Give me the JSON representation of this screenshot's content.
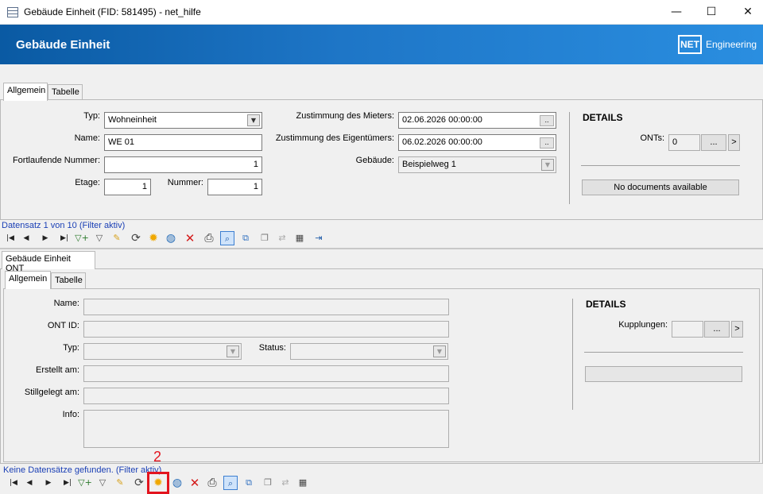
{
  "window": {
    "title": "Gebäude Einheit (FID: 581495) - net_hilfe",
    "minimize": "—",
    "maximize": "☐",
    "close": "✕"
  },
  "banner": {
    "title": "Gebäude Einheit",
    "logo": "NET",
    "logo_text": "Engineering"
  },
  "top_tabs": [
    "Allgemein",
    "Tabelle"
  ],
  "top_form": {
    "typ_label": "Typ:",
    "typ_value": "Wohneinheit",
    "name_label": "Name:",
    "name_value": "WE 01",
    "fortlaufende_label": "Fortlaufende Nummer:",
    "fortlaufende_value": "1",
    "etage_label": "Etage:",
    "etage_value": "1",
    "nummer_label": "Nummer:",
    "nummer_value": "1",
    "mieter_label": "Zustimmung des Mieters:",
    "mieter_value": "02.06.2026 00:00:00",
    "eigentuemer_label": "Zustimmung des Eigentümers:",
    "eigentuemer_value": "06.02.2026 00:00:00",
    "gebaeude_label": "Gebäude:",
    "gebaeude_value": "Beispielweg 1",
    "dots": ".."
  },
  "top_details": {
    "heading": "DETAILS",
    "onts_label": "ONTs:",
    "onts_value": "0",
    "more": "...",
    "arrow": ">",
    "no_docs": "No documents available"
  },
  "top_status": "Datensatz 1 von 10 (Filter aktiv)",
  "ont_section": {
    "tab": "Gebäude Einheit ONT",
    "subtabs": [
      "Allgemein",
      "Tabelle"
    ]
  },
  "ont_form": {
    "name_label": "Name:",
    "ont_id_label": "ONT ID:",
    "typ_label": "Typ:",
    "status_label": "Status:",
    "erstellt_label": "Erstellt am:",
    "stillgelegt_label": "Stillgelegt am:",
    "info_label": "Info:"
  },
  "ont_details": {
    "heading": "DETAILS",
    "kupplungen_label": "Kupplungen:",
    "more": "...",
    "arrow": ">"
  },
  "bottom_status": "Keine Datensätze gefunden. (Filter aktiv)",
  "annotation": {
    "step": "2"
  },
  "toolbar_icons": [
    "first-icon",
    "prev-icon",
    "next-icon",
    "last-icon",
    "add-filter-icon",
    "filter-icon",
    "edit-icon",
    "refresh-icon",
    "new-icon",
    "globe-icon",
    "delete-icon",
    "print-icon",
    "zoom-icon",
    "select-icon",
    "copy-icon",
    "merge-icon",
    "table-icon",
    "exit-icon"
  ],
  "colors": {
    "banner": "#0a5aa3",
    "status_text": "#1a3fb5",
    "highlight": "#e3141e"
  }
}
